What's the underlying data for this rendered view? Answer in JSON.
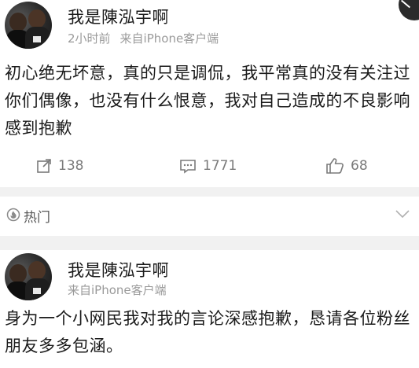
{
  "post1": {
    "username": "我是陳泓宇啊",
    "time": "2小时前",
    "source": "来自iPhone客户端",
    "text": "初心绝无坏意，真的只是调侃，我平常真的没有关注过你们偶像，也没有什么恨意，我对自己造成的不良影响感到抱歉",
    "repost_count": "138",
    "comment_count": "1771",
    "like_count": "68"
  },
  "section": {
    "label": "热门",
    "icon": "hot-search-icon"
  },
  "post2": {
    "username": "我是陳泓宇啊",
    "source": "来自iPhone客户端",
    "text": "身为一个小网民我对我的言论深感抱歉，恳请各位粉丝朋友多多包涵。"
  },
  "colors": {
    "text": "#1a1a1a",
    "meta": "#9a9a9a",
    "divider": "#f1f1f1"
  }
}
